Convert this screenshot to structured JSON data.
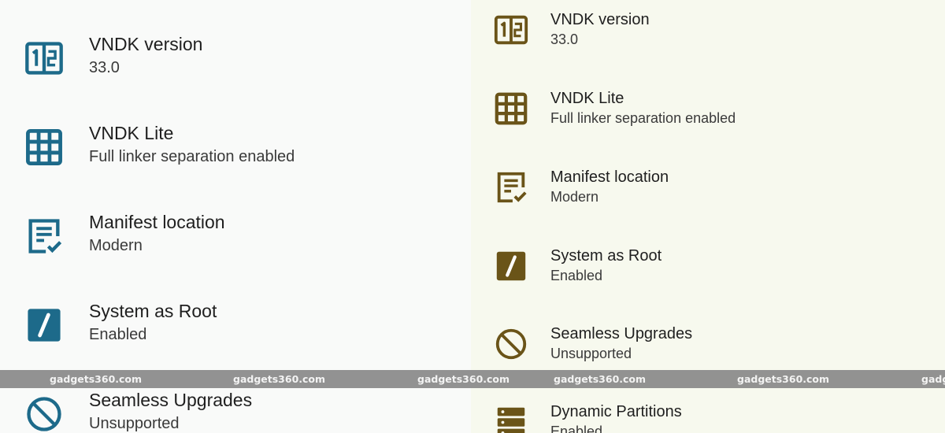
{
  "colors": {
    "left_accent": "#1d6a8a",
    "right_accent": "#6a5418"
  },
  "left_list": [
    {
      "icon": "number-blocks-icon",
      "title": "VNDK version",
      "subtitle": "33.0"
    },
    {
      "icon": "grid-icon",
      "title": "VNDK Lite",
      "subtitle": "Full linker separation enabled"
    },
    {
      "icon": "document-check-icon",
      "title": "Manifest location",
      "subtitle": "Modern"
    },
    {
      "icon": "slash-square-icon",
      "title": "System as Root",
      "subtitle": "Enabled"
    },
    {
      "icon": "no-update-icon",
      "title": "Seamless Upgrades",
      "subtitle": "Unsupported"
    }
  ],
  "right_list": [
    {
      "icon": "number-blocks-icon",
      "title": "VNDK version",
      "subtitle": "33.0"
    },
    {
      "icon": "grid-icon",
      "title": "VNDK Lite",
      "subtitle": "Full linker separation enabled"
    },
    {
      "icon": "document-check-icon",
      "title": "Manifest location",
      "subtitle": "Modern"
    },
    {
      "icon": "slash-square-icon",
      "title": "System as Root",
      "subtitle": "Enabled"
    },
    {
      "icon": "no-update-icon",
      "title": "Seamless Upgrades",
      "subtitle": "Unsupported"
    },
    {
      "icon": "partitions-icon",
      "title": "Dynamic Partitions",
      "subtitle": "Enabled"
    }
  ],
  "watermark": [
    "gadgets360.com",
    "gadgets360.com",
    "gadgets360.com",
    "gadgets360.com",
    "gadgets360.com",
    "gadg"
  ]
}
